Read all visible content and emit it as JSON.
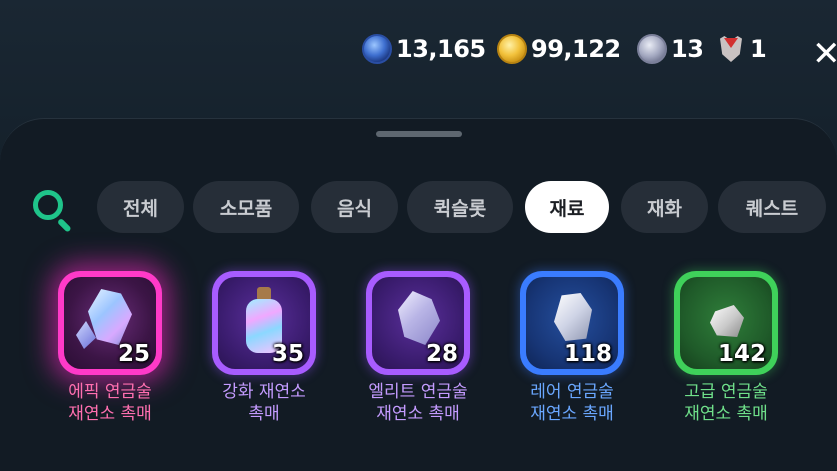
{
  "currencies": [
    {
      "icon": "blue-orb-icon",
      "value": "13,165"
    },
    {
      "icon": "gold-coin-icon",
      "value": "99,122"
    },
    {
      "icon": "silver-coin-icon",
      "value": "13"
    },
    {
      "icon": "demon-mask-icon",
      "value": "1"
    }
  ],
  "close_label": "✕",
  "tabs": [
    {
      "label": "전체",
      "active": false
    },
    {
      "label": "소모품",
      "active": false
    },
    {
      "label": "음식",
      "active": false
    },
    {
      "label": "퀵슬롯",
      "active": false
    },
    {
      "label": "재료",
      "active": true
    },
    {
      "label": "재화",
      "active": false
    },
    {
      "label": "퀘스트",
      "active": false
    }
  ],
  "items": [
    {
      "name_line1": "에픽 연금술",
      "name_line2": "재연소 촉매",
      "qty": "25",
      "rarity": "epic",
      "color": "#ff6fb0"
    },
    {
      "name_line1": "강화 재연소",
      "name_line2": "촉매",
      "qty": "35",
      "rarity": "purple",
      "color": "#c49bff"
    },
    {
      "name_line1": "엘리트 연금술",
      "name_line2": "재연소 촉매",
      "qty": "28",
      "rarity": "purple",
      "color": "#c49bff"
    },
    {
      "name_line1": "레어 연금술",
      "name_line2": "재연소 촉매",
      "qty": "118",
      "rarity": "blue",
      "color": "#6aa7ff"
    },
    {
      "name_line1": "고급 연금술",
      "name_line2": "재연소 촉매",
      "qty": "142",
      "rarity": "green",
      "color": "#6fe08a"
    }
  ]
}
